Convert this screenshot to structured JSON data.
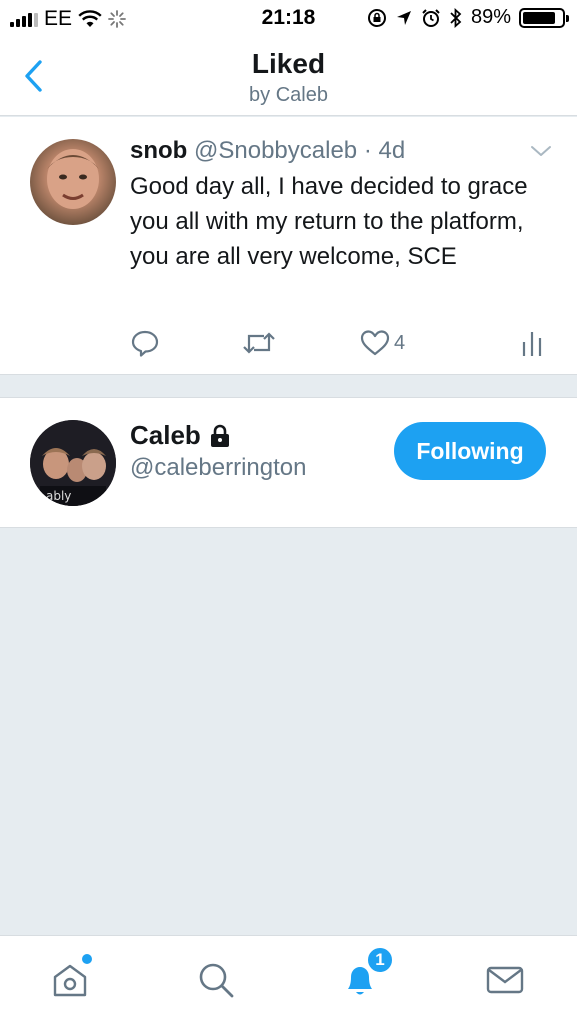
{
  "status_bar": {
    "carrier": "EE",
    "time": "21:18",
    "battery": "89%",
    "icons": [
      "signal-icon",
      "wifi-icon",
      "loading-icon",
      "screen-lock-icon",
      "location-icon",
      "alarm-icon",
      "bluetooth-icon",
      "battery-icon"
    ]
  },
  "header": {
    "title": "Liked",
    "subtitle": "by Caleb",
    "back_icon": "chevron-left-icon"
  },
  "tweet": {
    "name": "snob",
    "handle": "@Snobbycaleb",
    "separator": "·",
    "time": "4d",
    "text": "Good day all, I have decided to grace you all with my return to the platform, you are all very welcome, SCE",
    "like_count": "4",
    "icons": [
      "reply-icon",
      "retweet-icon",
      "like-icon",
      "analytics-icon",
      "chevron-down-icon"
    ]
  },
  "user": {
    "name": "Caleb",
    "handle": "@caleberrington",
    "follow_label": "Following",
    "protected_icon": "lock-icon"
  },
  "tab_bar": {
    "items": [
      "home",
      "search",
      "notifications",
      "messages"
    ],
    "notifications_badge": "1"
  },
  "colors": {
    "accent": "#1da1f2",
    "text_primary": "#14171a",
    "text_secondary": "#657786",
    "background": "#e6ecf0"
  }
}
